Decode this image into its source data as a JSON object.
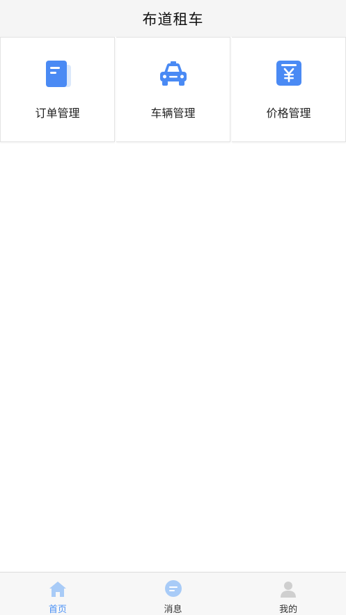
{
  "header": {
    "title": "布道租车"
  },
  "menu": {
    "items": [
      {
        "label": "订单管理",
        "icon": "order-icon"
      },
      {
        "label": "车辆管理",
        "icon": "car-icon"
      },
      {
        "label": "价格管理",
        "icon": "price-icon"
      }
    ]
  },
  "tabbar": {
    "items": [
      {
        "label": "首页",
        "icon": "home-icon",
        "active": true
      },
      {
        "label": "消息",
        "icon": "message-icon",
        "active": false
      },
      {
        "label": "我的",
        "icon": "profile-icon",
        "active": false
      }
    ]
  },
  "colors": {
    "accent": "#4a8af4",
    "accent_light": "#a8cbf7",
    "inactive_icon": "#cfcfcf",
    "header_bg": "#f5f5f5"
  }
}
